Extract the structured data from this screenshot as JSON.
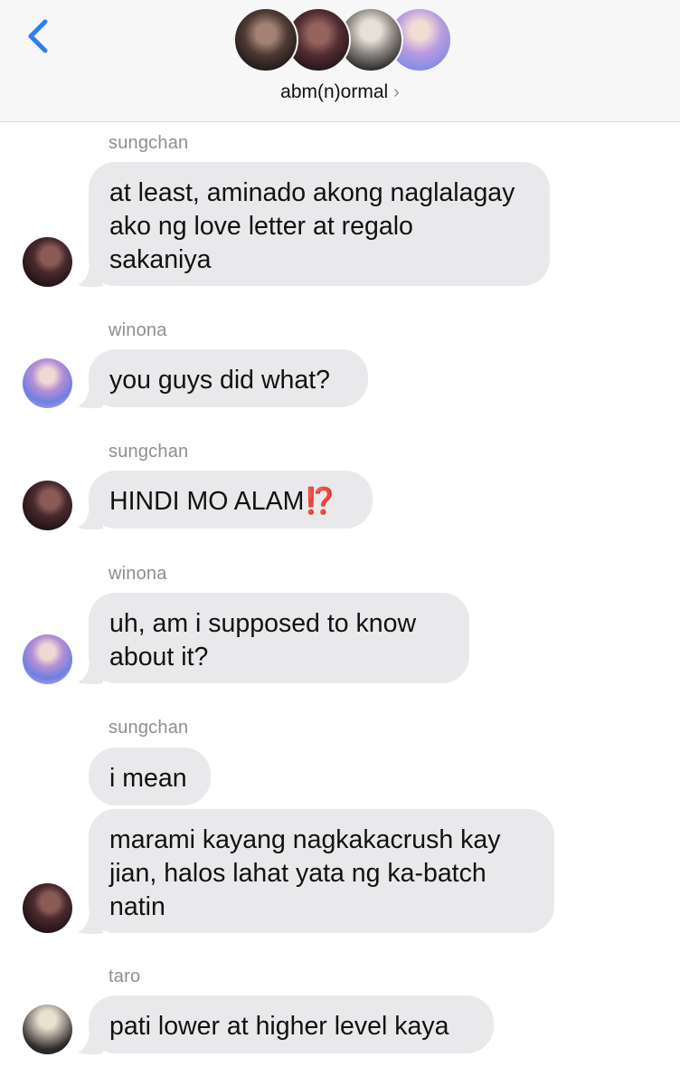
{
  "header": {
    "back_icon": "chevron-left-icon",
    "group_name": "abm(n)ormal",
    "disclosure_icon": "chevron-right-icon",
    "accent_color": "#2f7cf6"
  },
  "messages": [
    {
      "sender": "sungchan",
      "lines": [
        "at least, aminado akong naglalagay",
        "ako ng love letter at regalo",
        "sakaniya"
      ]
    },
    {
      "sender": "winona",
      "lines": [
        "you guys did what?"
      ]
    },
    {
      "sender": "sungchan",
      "lines": [
        "HINDI MO ALAM⁉️"
      ]
    },
    {
      "sender": "winona",
      "lines": [
        "uh, am i supposed to know",
        "about it?"
      ]
    },
    {
      "sender": "sungchan",
      "lines": [
        "i mean"
      ]
    },
    {
      "sender": "sungchan",
      "lines": [
        "marami kayang nagkakacrush kay",
        "jian, halos lahat yata ng ka-batch",
        "natin"
      ]
    },
    {
      "sender": "taro",
      "lines": [
        "pati lower at higher level kaya"
      ]
    }
  ]
}
